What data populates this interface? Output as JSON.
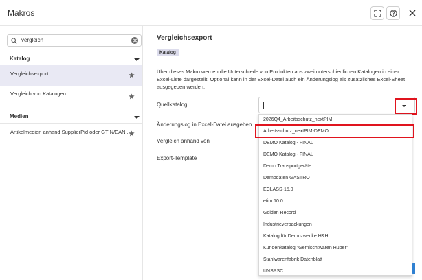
{
  "window": {
    "title": "Makros"
  },
  "icons": {
    "fullscreen": "fullscreen-icon",
    "help": "help-icon",
    "close": "close-icon",
    "search": "search-icon",
    "clear": "clear-icon",
    "star": "star-icon",
    "chevron": "chevron-down-icon"
  },
  "sidebar": {
    "search": {
      "value": "vergleich"
    },
    "groups": [
      {
        "label": "Katalog",
        "items": [
          {
            "label": "Vergleichsexport"
          },
          {
            "label": "Vergleich von Katalogen"
          }
        ]
      },
      {
        "label": "Medien",
        "items": [
          {
            "label": "Artikelmedien anhand SupplierPid oder GTIN/EAN ..."
          }
        ]
      }
    ]
  },
  "main": {
    "title": "Vergleichsexport",
    "badge": "Katalog",
    "description": "Über dieses Makro werden die Unterschiede von Produkten aus zwei unterschiedlichen Katalogen in einer Excel-Liste dargestellt. Optional kann in der Excel-Datei auch ein Änderungslog als zusätzliches Excel-Sheet ausgegeben werden.",
    "fields": [
      {
        "label": "Quellkatalog"
      },
      {
        "label": "Änderungslog in Excel-Datei ausgeben"
      },
      {
        "label": "Vergleich anhand von"
      },
      {
        "label": "Export-Template"
      }
    ],
    "quellkatalog": {
      "value": "",
      "options": [
        "2026Q4_Arbeitsschutz_nextPIM",
        "Arbeitsschutz_nextPIM-DEMO",
        "DEMO Katalog - FINAL",
        "DEMO Katalog - FINAL",
        "Demo Transportgeräte",
        "Demodaten GASTRO",
        "ECLASS-15.0",
        "etim 10.0",
        "Golden Record",
        "Industrieverpackungen",
        "Katalog für Demozwecke H&H",
        "Kundenkatalog \"Gemischtwaren Huber\"",
        "Stahlwarenfabrik Datenblatt",
        "UNSPSC"
      ]
    }
  },
  "colors": {
    "highlight": "#e0141e",
    "active_item_bg": "#e9e9f4",
    "badge_bg": "#dcdcec",
    "primary": "#2f80d1"
  }
}
